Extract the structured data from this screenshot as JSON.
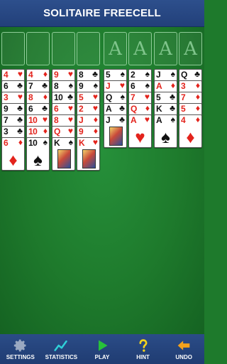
{
  "header": {
    "title": "SOLITAIRE FREECELL"
  },
  "freecells": [
    {},
    {},
    {},
    {}
  ],
  "foundations": [
    {
      "label": "A"
    },
    {
      "label": "A"
    },
    {
      "label": "A"
    },
    {
      "label": "A"
    }
  ],
  "columns": [
    {
      "cards": [
        {
          "rank": "4",
          "suit": "♥",
          "color": "red"
        },
        {
          "rank": "6",
          "suit": "♣",
          "color": "black"
        },
        {
          "rank": "3",
          "suit": "♥",
          "color": "red"
        },
        {
          "rank": "9",
          "suit": "♣",
          "color": "black"
        },
        {
          "rank": "7",
          "suit": "♣",
          "color": "black"
        },
        {
          "rank": "3",
          "suit": "♣",
          "color": "black"
        },
        {
          "rank": "6",
          "suit": "♦",
          "color": "red"
        }
      ]
    },
    {
      "cards": [
        {
          "rank": "4",
          "suit": "♦",
          "color": "red"
        },
        {
          "rank": "7",
          "suit": "♣",
          "color": "black"
        },
        {
          "rank": "8",
          "suit": "♦",
          "color": "red"
        },
        {
          "rank": "6",
          "suit": "♣",
          "color": "black"
        },
        {
          "rank": "10",
          "suit": "♥",
          "color": "red"
        },
        {
          "rank": "10",
          "suit": "♦",
          "color": "red"
        },
        {
          "rank": "10",
          "suit": "♠",
          "color": "black"
        }
      ]
    },
    {
      "cards": [
        {
          "rank": "9",
          "suit": "♥",
          "color": "red"
        },
        {
          "rank": "8",
          "suit": "♠",
          "color": "black"
        },
        {
          "rank": "10",
          "suit": "♣",
          "color": "black"
        },
        {
          "rank": "6",
          "suit": "♥",
          "color": "red"
        },
        {
          "rank": "8",
          "suit": "♥",
          "color": "red"
        },
        {
          "rank": "Q",
          "suit": "♥",
          "color": "red"
        },
        {
          "rank": "K",
          "suit": "♠",
          "color": "black"
        }
      ]
    },
    {
      "cards": [
        {
          "rank": "8",
          "suit": "♣",
          "color": "black"
        },
        {
          "rank": "9",
          "suit": "♠",
          "color": "black"
        },
        {
          "rank": "5",
          "suit": "♥",
          "color": "red"
        },
        {
          "rank": "2",
          "suit": "♥",
          "color": "red"
        },
        {
          "rank": "J",
          "suit": "♦",
          "color": "red"
        },
        {
          "rank": "9",
          "suit": "♦",
          "color": "red"
        },
        {
          "rank": "K",
          "suit": "♥",
          "color": "red"
        }
      ]
    },
    {
      "cards": [
        {
          "rank": "5",
          "suit": "♠",
          "color": "black"
        },
        {
          "rank": "J",
          "suit": "♥",
          "color": "red"
        },
        {
          "rank": "Q",
          "suit": "♠",
          "color": "black"
        },
        {
          "rank": "A",
          "suit": "♣",
          "color": "black"
        },
        {
          "rank": "J",
          "suit": "♣",
          "color": "black"
        }
      ]
    },
    {
      "cards": [
        {
          "rank": "2",
          "suit": "♠",
          "color": "black"
        },
        {
          "rank": "6",
          "suit": "♠",
          "color": "black"
        },
        {
          "rank": "7",
          "suit": "♥",
          "color": "red"
        },
        {
          "rank": "Q",
          "suit": "♦",
          "color": "red"
        },
        {
          "rank": "A",
          "suit": "♥",
          "color": "red"
        }
      ]
    },
    {
      "cards": [
        {
          "rank": "J",
          "suit": "♠",
          "color": "black"
        },
        {
          "rank": "A",
          "suit": "♦",
          "color": "red"
        },
        {
          "rank": "5",
          "suit": "♣",
          "color": "black"
        },
        {
          "rank": "K",
          "suit": "♣",
          "color": "black"
        },
        {
          "rank": "A",
          "suit": "♠",
          "color": "black"
        }
      ]
    },
    {
      "cards": [
        {
          "rank": "Q",
          "suit": "♣",
          "color": "black"
        },
        {
          "rank": "3",
          "suit": "♦",
          "color": "red"
        },
        {
          "rank": "7",
          "suit": "♦",
          "color": "red"
        },
        {
          "rank": "5",
          "suit": "♦",
          "color": "red"
        },
        {
          "rank": "4",
          "suit": "♦",
          "color": "red"
        }
      ]
    }
  ],
  "toolbar": {
    "settings": {
      "label": "SETTINGS",
      "icon": "gear-icon",
      "color": "#9aa9c2"
    },
    "statistics": {
      "label": "STATISTICS",
      "icon": "chart-icon",
      "color": "#2fd0d8"
    },
    "play": {
      "label": "PLAY",
      "icon": "play-icon",
      "color": "#27c23a"
    },
    "hint": {
      "label": "HINT",
      "icon": "question-icon",
      "color": "#f3d21c"
    },
    "undo": {
      "label": "UNDO",
      "icon": "undo-arrow-icon",
      "color": "#f3a21c"
    }
  },
  "colors": {
    "felt": "#1e7a2c",
    "header": "#2d4f8c",
    "red_suit": "#e3231c",
    "black_suit": "#111111"
  }
}
